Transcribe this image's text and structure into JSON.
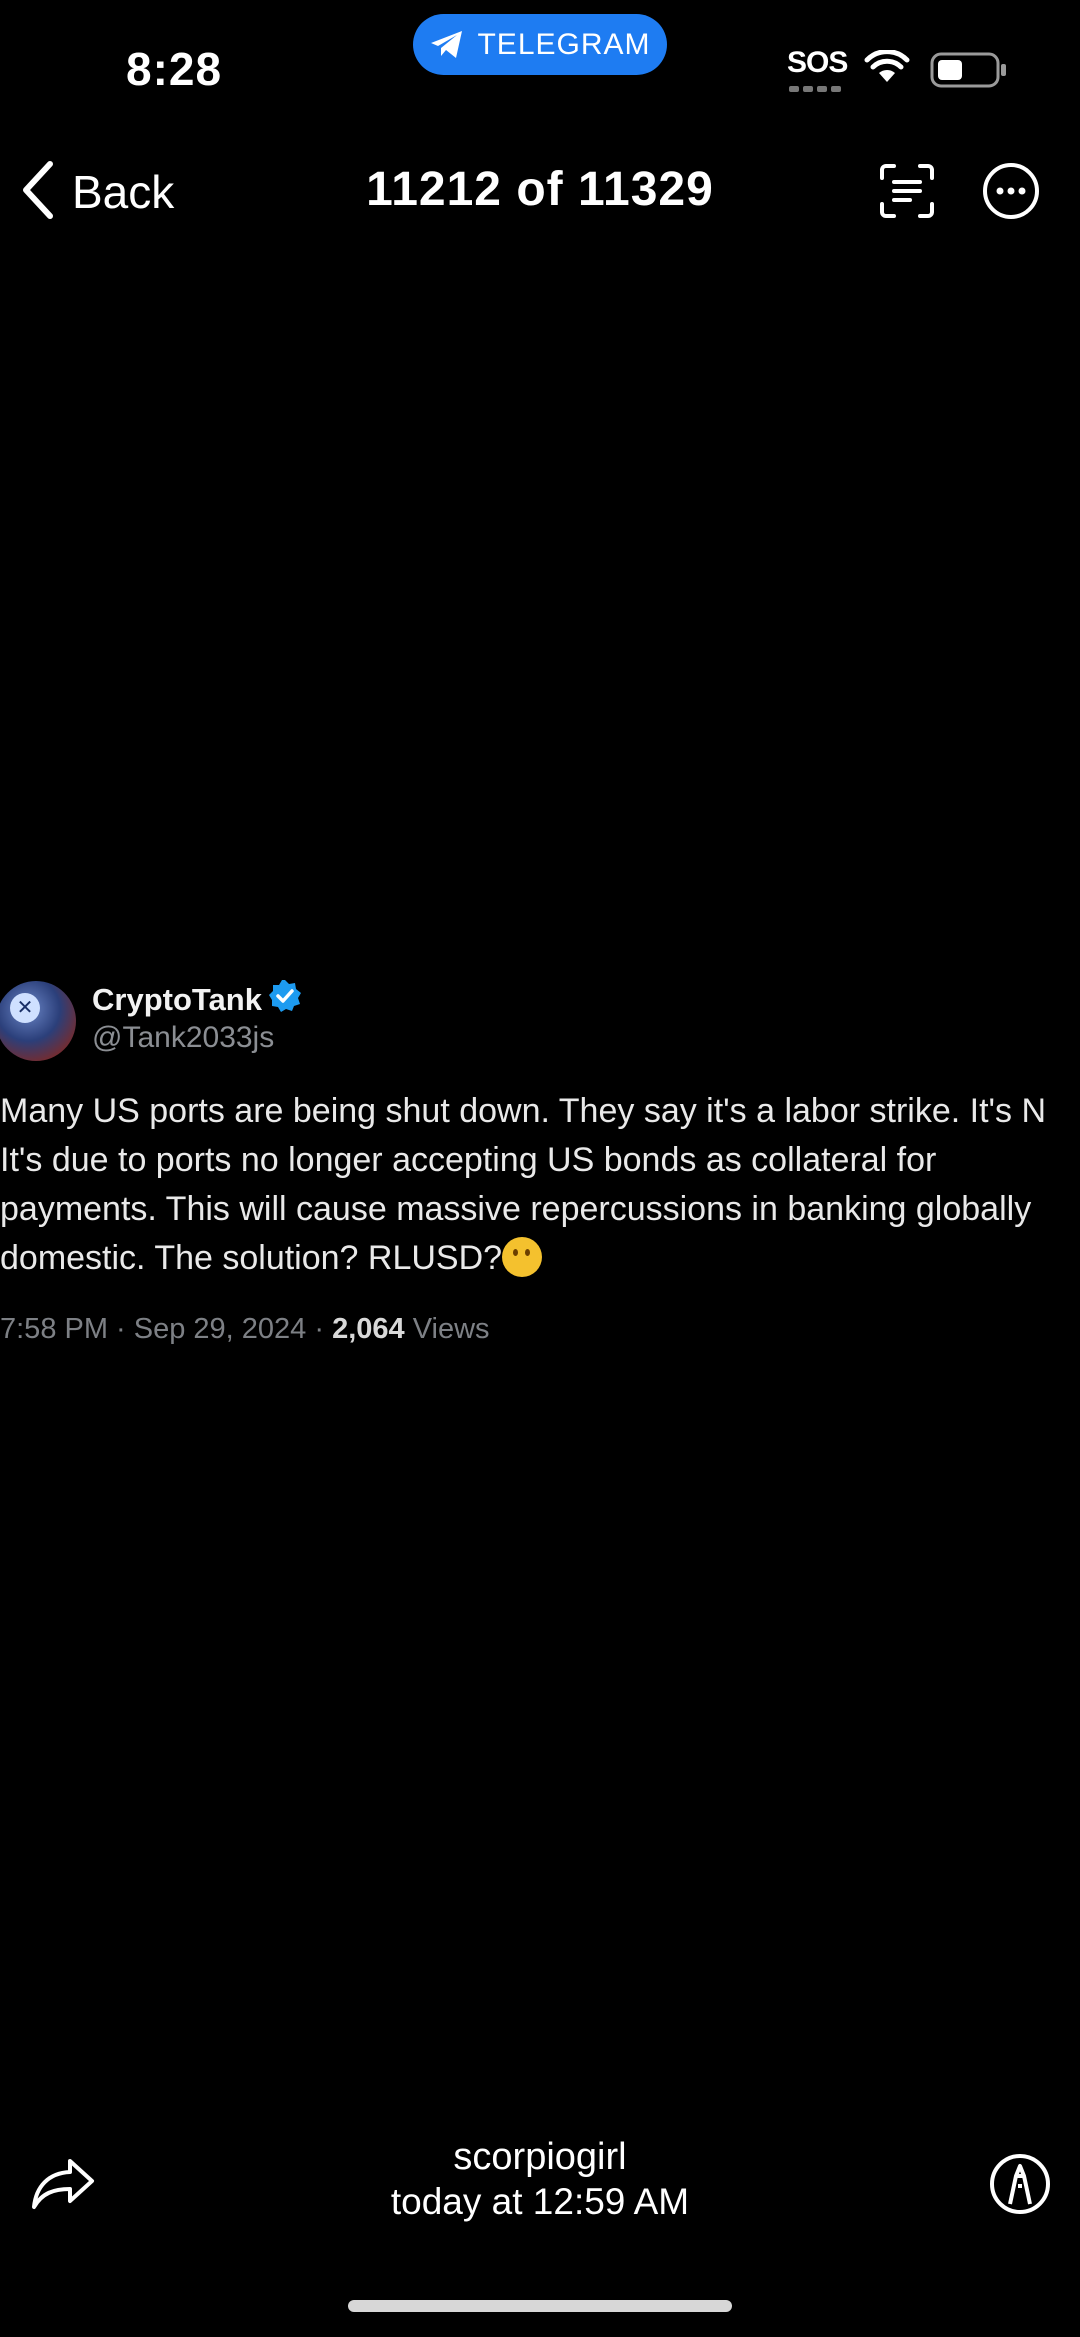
{
  "status_bar": {
    "time": "8:28",
    "app_pill_label": "TELEGRAM",
    "sos_label": "SOS"
  },
  "nav": {
    "back_label": "Back",
    "title": "11212 of 11329"
  },
  "tweet": {
    "display_name": "CryptoTank",
    "handle": "@Tank2033js",
    "avatar_glyph": "✕",
    "body_lines": [
      "Many US ports are being shut down. They say it's a labor strike. It's N",
      "It's due to ports no longer accepting US bonds as collateral for",
      "payments. This will cause massive repercussions in banking globally",
      "domestic. The solution? RLUSD?"
    ],
    "meta_time": "7:58 PM · Sep 29, 2024 · ",
    "views_count": "2,064",
    "views_label": " Views"
  },
  "footer": {
    "sender_name": "scorpiogirl",
    "sent_time": "today at 12:59 AM"
  },
  "colors": {
    "background": "#000000",
    "telegram_blue": "#1e7cf2",
    "verified_blue": "#1d9bf0",
    "muted_text": "#8b8e93"
  },
  "icons": [
    "telegram-plane-icon",
    "wifi-icon",
    "battery-icon",
    "chevron-left-icon",
    "live-text-scan-icon",
    "more-icon",
    "verified-badge-icon",
    "thinking-face-emoji",
    "share-icon",
    "markup-icon"
  ]
}
